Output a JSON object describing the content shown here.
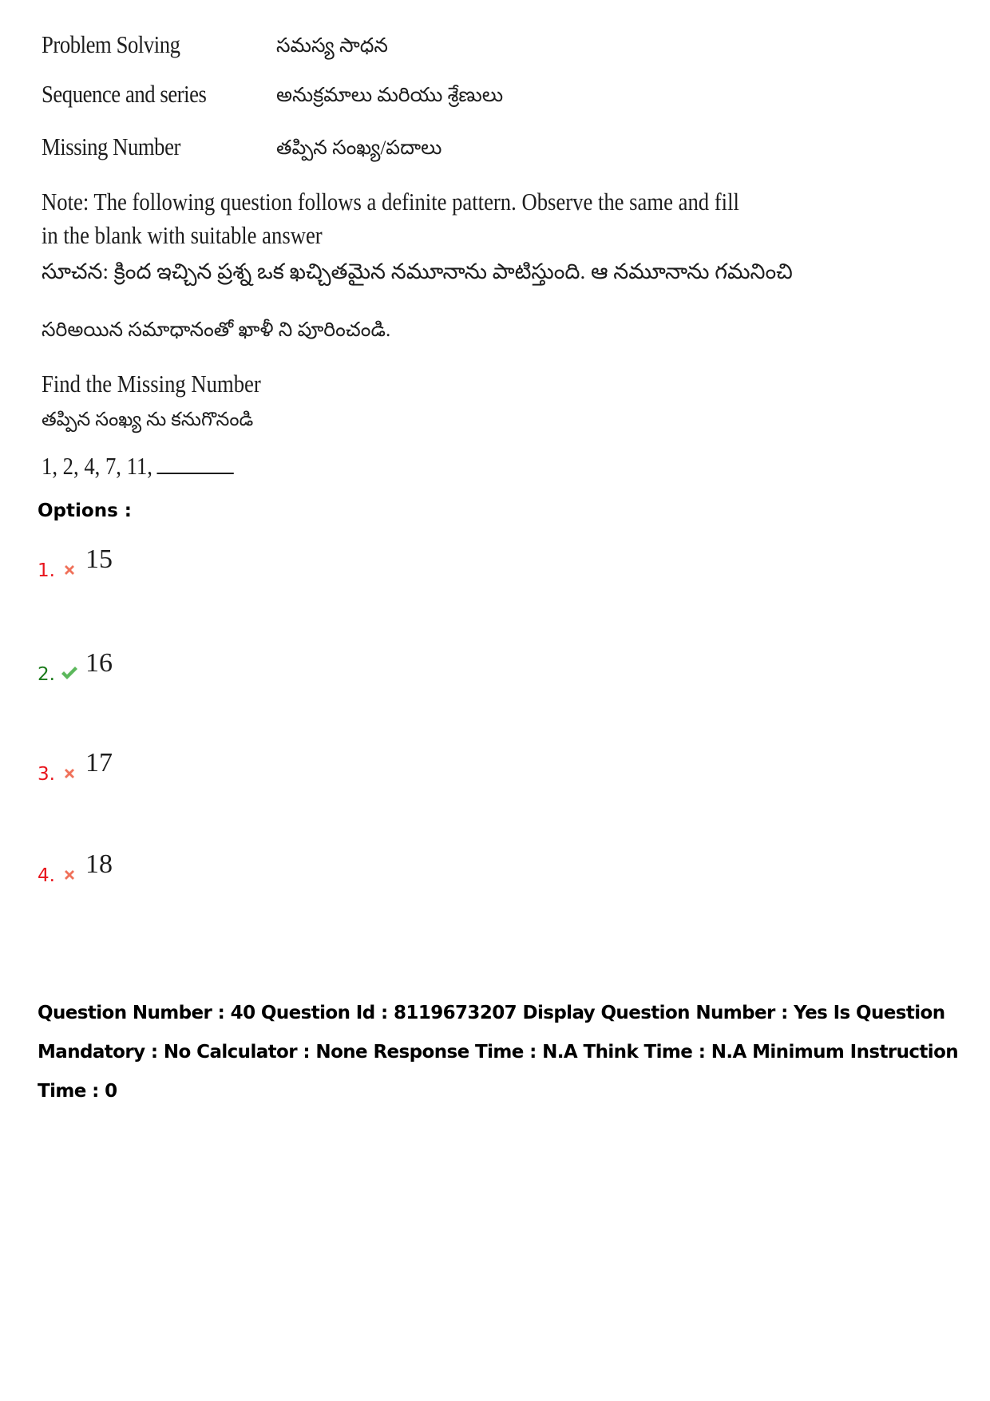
{
  "topics": [
    {
      "english": "Problem Solving",
      "telugu": "సమస్య సాధన"
    },
    {
      "english": "Sequence and series",
      "telugu": "అనుక్రమాలు మరియు శ్రేణులు"
    },
    {
      "english": "Missing Number",
      "telugu": "తప్పిన సంఖ్య/పదాలు"
    }
  ],
  "note": {
    "english": "Note:  The following question follows a definite pattern. Observe the same and fill in the blank with suitable answer",
    "telugu_line1": "సూచన: క్రింద  ఇచ్చిన ప్రశ్న  ఒక ఖచ్చితమైన నమూనాను పాటిస్తుంది. ఆ నమూనాను గమనించి",
    "telugu_line2": "సరిఅయిన సమాధానంతో ఖాళీ ని పూరించండి."
  },
  "question": {
    "english": "Find the Missing Number",
    "telugu": "తప్పిన  సంఖ్య  ను  కనుగొనండి",
    "sequence": "1, 2, 4, 7, 11,"
  },
  "options_label": "Options :",
  "options": [
    {
      "number": "1.",
      "value": "15",
      "status": "wrong",
      "icon": "cross-icon"
    },
    {
      "number": "2.",
      "value": "16",
      "status": "correct",
      "icon": "check-icon"
    },
    {
      "number": "3.",
      "value": "17",
      "status": "wrong",
      "icon": "cross-icon"
    },
    {
      "number": "4.",
      "value": "18",
      "status": "wrong",
      "icon": "cross-icon"
    }
  ],
  "colors": {
    "wrong": "#e8141c",
    "correct": "#1a7a1a",
    "cross_icon": "#f0715a",
    "check_icon": "#5cb85c"
  },
  "meta": {
    "text": "Question Number : 40 Question Id : 8119673207 Display Question Number : Yes Is Question Mandatory : No Calculator : None Response Time : N.A Think Time : N.A Minimum Instruction Time : 0"
  }
}
